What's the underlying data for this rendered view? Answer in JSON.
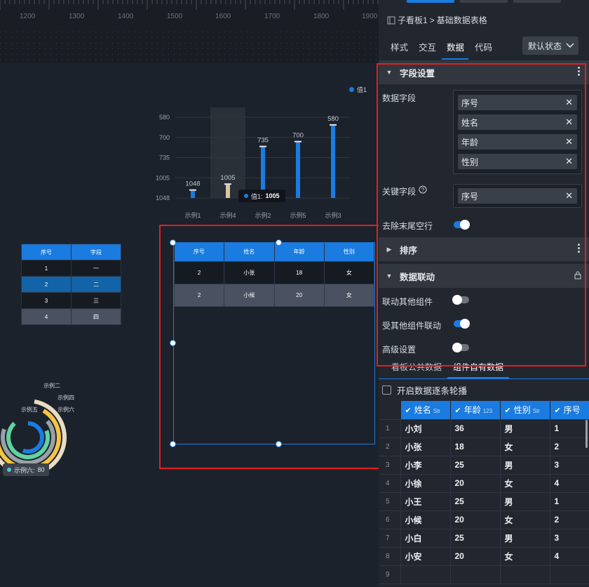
{
  "ruler": {
    "labels": [
      "1200",
      "1300",
      "1400",
      "1500",
      "1600",
      "1700",
      "1800",
      "1900"
    ]
  },
  "chart": {
    "legend": "值1",
    "tooltip": {
      "label": "值1:",
      "value": "1005"
    }
  },
  "chart_data": {
    "type": "bar",
    "categories": [
      "示例1",
      "示例4",
      "示例2",
      "示例5",
      "示例3"
    ],
    "values": [
      1048,
      1005,
      735,
      700,
      580
    ],
    "yticks": [
      "580",
      "700",
      "735",
      "1005",
      "1048"
    ],
    "highlighted_category": "示例4",
    "series": [
      {
        "name": "值1",
        "values": [
          1048,
          1005,
          735,
          700,
          580
        ]
      }
    ],
    "colors": {
      "bar": "#1a7be0",
      "highlight": "#d9c7a0"
    }
  },
  "small_table": {
    "headers": [
      "序号",
      "字段"
    ],
    "rows": [
      [
        "1",
        "一"
      ],
      [
        "2",
        "二"
      ],
      [
        "3",
        "三"
      ],
      [
        "4",
        "四"
      ]
    ]
  },
  "selected_table": {
    "headers": [
      "序号",
      "姓名",
      "年龄",
      "性别"
    ],
    "rows": [
      [
        "2",
        "小张",
        "18",
        "女"
      ],
      [
        "2",
        "小候",
        "20",
        "女"
      ]
    ]
  },
  "ring_chart": {
    "tooltip_label": "示例六:",
    "tooltip_value": "80",
    "legend": [
      "示例二",
      "示例四",
      "示例五",
      "示例六"
    ]
  },
  "panel": {
    "breadcrumb": {
      "parent": "子看板1",
      "sep": ">",
      "current": "基础数据表格"
    },
    "tabs": [
      "样式",
      "交互",
      "数据",
      "代码"
    ],
    "active_tab": "数据",
    "state_select": "默认状态",
    "field_section": {
      "title": "字段设置",
      "data_field_label": "数据字段",
      "data_fields": [
        "序号",
        "姓名",
        "年龄",
        "性别"
      ],
      "key_field_label": "关键字段",
      "key_field": "序号",
      "trim_label": "去除末尾空行",
      "trim_on": true
    },
    "sort_section": {
      "title": "排序"
    },
    "link_section": {
      "title": "数据联动",
      "link_others": "联动其他组件",
      "link_others_on": false,
      "linked_by": "受其他组件联动",
      "linked_by_on": true,
      "advanced": "高级设置",
      "advanced_on": false
    },
    "subtabs": [
      "看板公共数据",
      "组件自有数据"
    ],
    "active_subtab": "组件自有数据",
    "carousel_label": "开启数据逐条轮播",
    "grid": {
      "columns": [
        {
          "name": "姓名",
          "type": "Str"
        },
        {
          "name": "年龄",
          "type": "123"
        },
        {
          "name": "性别",
          "type": "Str"
        },
        {
          "name": "序号",
          "type": ""
        }
      ],
      "rows": [
        [
          "1",
          "小刘",
          "36",
          "男",
          "1"
        ],
        [
          "2",
          "小张",
          "18",
          "女",
          "2"
        ],
        [
          "3",
          "小李",
          "25",
          "男",
          "3"
        ],
        [
          "4",
          "小徐",
          "20",
          "女",
          "4"
        ],
        [
          "5",
          "小王",
          "25",
          "男",
          "1"
        ],
        [
          "6",
          "小候",
          "20",
          "女",
          "2"
        ],
        [
          "7",
          "小白",
          "25",
          "男",
          "3"
        ],
        [
          "8",
          "小安",
          "20",
          "女",
          "4"
        ],
        [
          "9",
          "",
          "",
          "",
          ""
        ]
      ]
    },
    "colors": {
      "accent": "#1a7be0",
      "highlight_border": "#e02020"
    }
  }
}
